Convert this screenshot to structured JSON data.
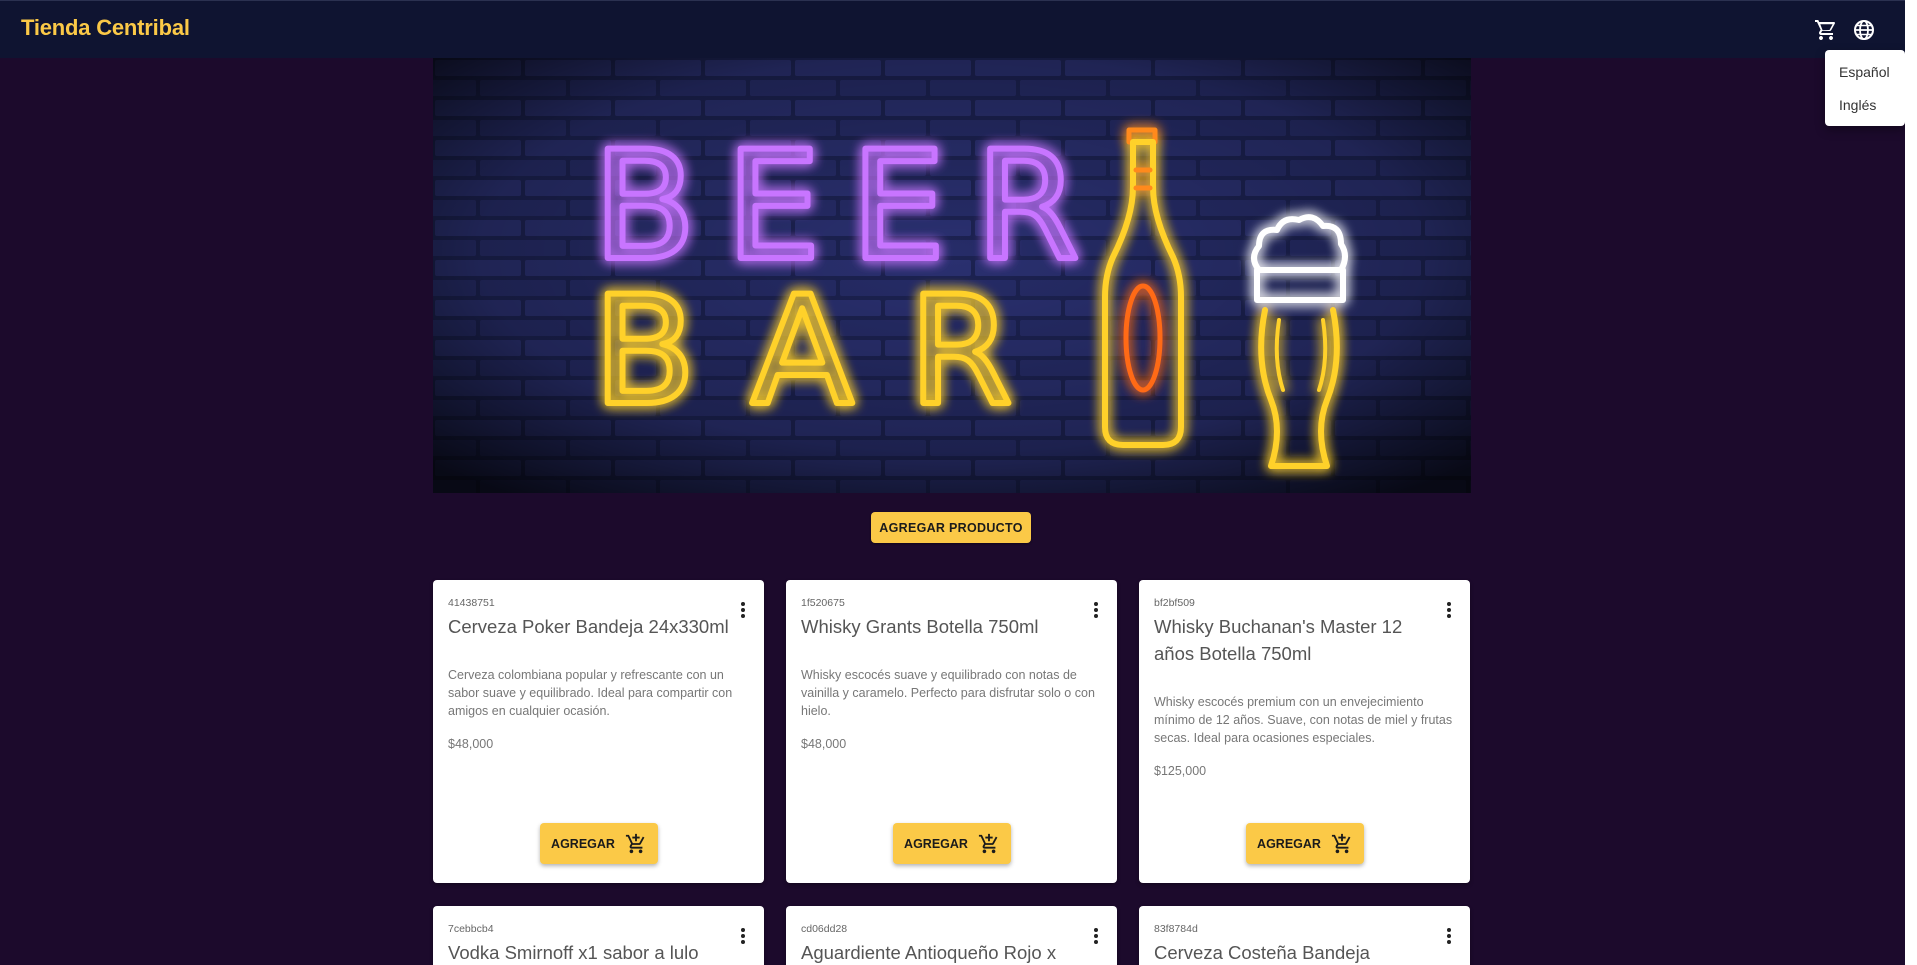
{
  "header": {
    "brand": "Tienda Centribal",
    "cart_icon": "cart-icon",
    "language_icon": "globe-icon"
  },
  "language_menu": {
    "items": [
      "Español",
      "Inglés"
    ]
  },
  "hero": {
    "line1": "BEER",
    "line2": "BAR"
  },
  "actions": {
    "add_product_label": "AGREGAR PRODUCTO"
  },
  "products": [
    {
      "id": "41438751",
      "title": "Cerveza Poker Bandeja 24x330ml",
      "description": "Cerveza colombiana popular y refrescante con un sabor suave y equilibrado. Ideal para compartir con amigos en cualquier ocasión.",
      "price": "$48,000",
      "add_label": "AGREGAR"
    },
    {
      "id": "1f520675",
      "title": "Whisky Grants Botella 750ml",
      "description": "Whisky escocés suave y equilibrado con notas de vainilla y caramelo. Perfecto para disfrutar solo o con hielo.",
      "price": "$48,000",
      "add_label": "AGREGAR"
    },
    {
      "id": "bf2bf509",
      "title": "Whisky Buchanan's Master 12 años Botella 750ml",
      "description": "Whisky escocés premium con un envejecimiento mínimo de 12 años. Suave, con notas de miel y frutas secas. Ideal para ocasiones especiales.",
      "price": "$125,000",
      "add_label": "AGREGAR"
    },
    {
      "id": "7cebbcb4",
      "title": "Vodka Smirnoff x1 sabor a lulo"
    },
    {
      "id": "cd06dd28",
      "title": "Aguardiente Antioqueño Rojo x"
    },
    {
      "id": "83f8784d",
      "title": "Cerveza Costeña Bandeja"
    }
  ],
  "colors": {
    "accent": "#fbc947",
    "topbar": "#0f1431",
    "background": "#1c0a2c"
  }
}
